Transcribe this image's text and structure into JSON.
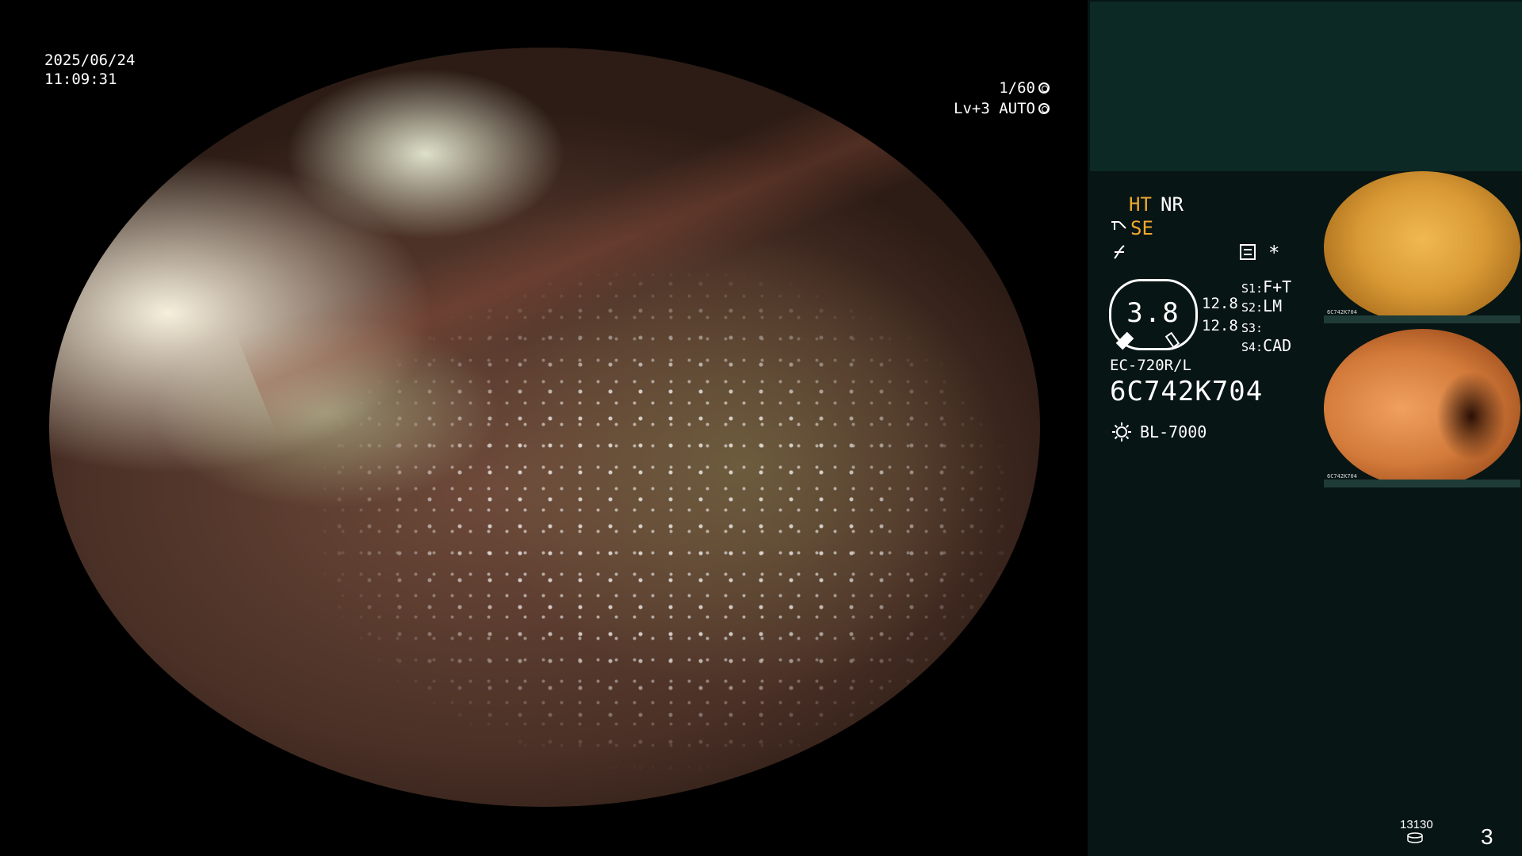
{
  "overlay": {
    "date": "2025/06/24",
    "time": "11:09:31",
    "shutter": "1/60",
    "level": "Lv+3 AUTO"
  },
  "panel": {
    "ht": "HT",
    "nr": "NR",
    "se": "SE",
    "asterisk": "*",
    "gauge_value": "3.8",
    "gauge_left_top": "12.8",
    "gauge_left_bottom": "12.8",
    "switches": [
      {
        "label": "S1:",
        "value": "F+T"
      },
      {
        "label": "S2:",
        "value": "LM"
      },
      {
        "label": "S3:",
        "value": ""
      },
      {
        "label": "S4:",
        "value": "CAD"
      }
    ],
    "scope_model": "EC-720R/L",
    "serial": "6C742K704",
    "light_source": "BL-7000"
  },
  "thumbnails": [
    {
      "caption": "6C742K704"
    },
    {
      "caption": "6C742K704"
    }
  ],
  "footer": {
    "counter": "13130",
    "page_number": "3"
  },
  "colors": {
    "accent_orange": "#f0a830",
    "panel_bg": "#071514",
    "panel_top_bg": "#0c2925"
  }
}
